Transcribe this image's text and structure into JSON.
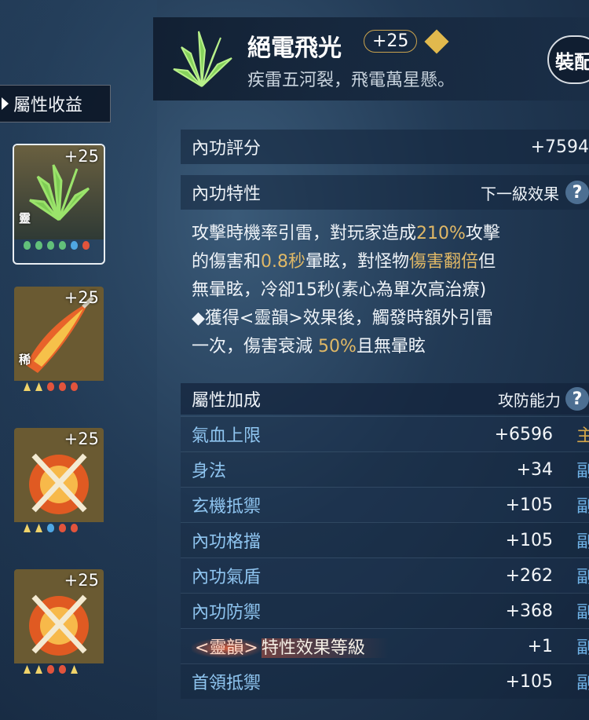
{
  "side": {
    "tab_label": "屬性收益"
  },
  "cards": [
    {
      "level": "+25",
      "tag": "靈",
      "gems": [
        "g",
        "g",
        "g",
        "g",
        "b",
        "r"
      ],
      "selected": true
    },
    {
      "level": "+25",
      "tag": "稀",
      "gems": [
        "y",
        "y",
        "r",
        "r",
        "r"
      ]
    },
    {
      "level": "+25",
      "tag": "",
      "gems": [
        "y",
        "y",
        "b",
        "r",
        "r"
      ]
    },
    {
      "level": "+25",
      "tag": "",
      "gems": [
        "y",
        "y",
        "r",
        "r",
        "y"
      ]
    }
  ],
  "header": {
    "title": "絕電飛光",
    "level": "+25",
    "verse": "疾雷五河裂，飛電萬星懸。",
    "equip_label": "裝配"
  },
  "score": {
    "label": "內功評分",
    "value": "+7594"
  },
  "trait": {
    "label": "內功特性",
    "next_label": "下一級效果",
    "help": "?",
    "line1_a": "攻擊時機率引雷，對玩家造成",
    "line1_b": "210%",
    "line1_c": "攻擊",
    "line2_a": "的傷害和",
    "line2_b": "0.8秒",
    "line2_c": "暈眩，對怪物",
    "line2_d": "傷害翻倍",
    "line2_e": "但",
    "line3": "無暈眩，冷卻15秒(素心為單次高治療)",
    "line4": "◆獲得<靈韻>效果後，觸發時額外引雷",
    "line5_a": "一次，傷害衰減 ",
    "line5_b": "50%",
    "line5_c": "且無暈眩"
  },
  "attributes": {
    "label": "屬性加成",
    "right_label": "攻防能力",
    "help": "?",
    "rows": [
      {
        "name": "氣血上限",
        "value": "+6596",
        "tag": "主"
      },
      {
        "name": "身法",
        "value": "+34",
        "tag": "副"
      },
      {
        "name": "玄機抵禦",
        "value": "+105",
        "tag": "副"
      },
      {
        "name": "內功格擋",
        "value": "+105",
        "tag": "副"
      },
      {
        "name": "內功氣盾",
        "value": "+262",
        "tag": "副"
      },
      {
        "name": "內功防禦",
        "value": "+368",
        "tag": "副"
      },
      {
        "name_a": "<靈韻>",
        "name_b": "特性效果等級",
        "value": "+1",
        "tag": "副"
      },
      {
        "name": "首領抵禦",
        "value": "+105",
        "tag": "副"
      }
    ]
  },
  "colors": {
    "highlight": "#e0b866",
    "attr_name": "#8fc5f0",
    "main_tag": "#d6a84b",
    "sub_tag": "#6fb2e6"
  }
}
